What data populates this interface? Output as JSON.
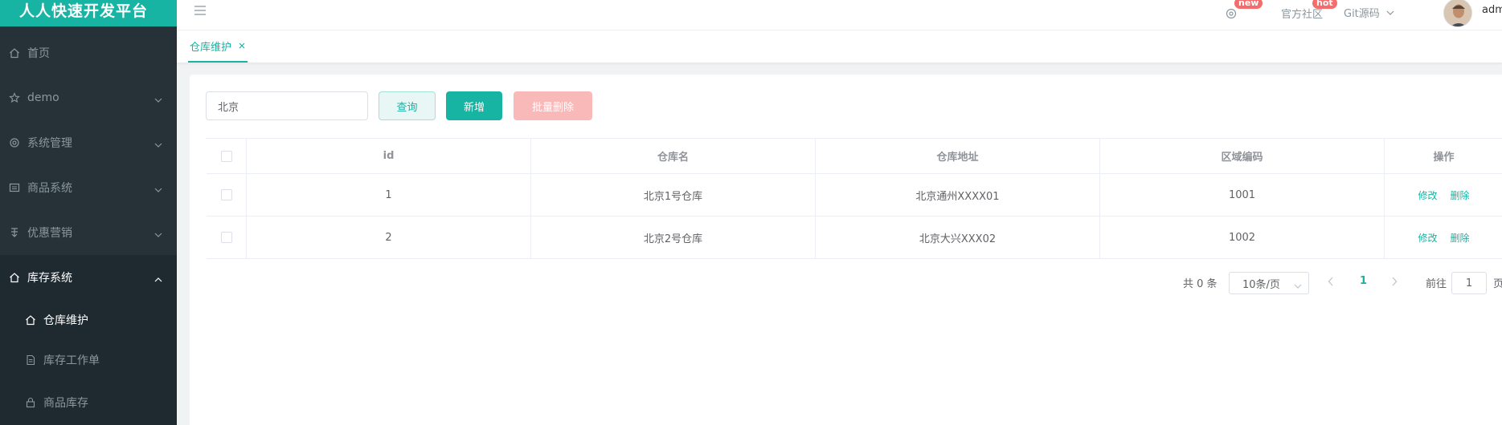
{
  "brand": {
    "title": "人人快速开发平台"
  },
  "sidebar": {
    "items": [
      {
        "label": "首页",
        "icon": "home-icon"
      },
      {
        "label": "demo",
        "icon": "star-icon"
      },
      {
        "label": "系统管理",
        "icon": "gear-icon"
      },
      {
        "label": "商品系统",
        "icon": "product-icon"
      },
      {
        "label": "优惠营销",
        "icon": "coupon-icon"
      },
      {
        "label": "库存系统",
        "icon": "warehouse-icon"
      }
    ],
    "sub_items": [
      {
        "label": "仓库维护",
        "icon": "home-icon"
      },
      {
        "label": "库存工作单",
        "icon": "document-icon"
      },
      {
        "label": "商品库存",
        "icon": "lock-icon"
      }
    ]
  },
  "navbar": {
    "new_badge": "new",
    "community": "官方社区",
    "hot_badge": "hot",
    "git": "Git源码",
    "username": "admi"
  },
  "tabs": [
    {
      "label": "仓库维护"
    }
  ],
  "search": {
    "value": "北京"
  },
  "buttons": {
    "query": "查询",
    "add": "新增",
    "batch_delete": "批量删除"
  },
  "table": {
    "headers": {
      "id": "id",
      "name": "仓库名",
      "address": "仓库地址",
      "area_code": "区域编码",
      "ops": "操作"
    },
    "rows": [
      {
        "id": "1",
        "name": "北京1号仓库",
        "address": "北京通州XXXX01",
        "area_code": "1001"
      },
      {
        "id": "2",
        "name": "北京2号仓库",
        "address": "北京大兴XXX02",
        "area_code": "1002"
      }
    ],
    "edit_label": "修改",
    "delete_label": "删除"
  },
  "pagination": {
    "total": "共 0 条",
    "page_size": "10条/页",
    "current_page": "1",
    "goto_label": "前往",
    "goto_value": "1",
    "page_suffix": "页"
  },
  "colors": {
    "accent": "#17b3a3",
    "sidebar_bg": "#263238",
    "danger_light": "#f9b9b9",
    "badge": "#f56c6c"
  }
}
